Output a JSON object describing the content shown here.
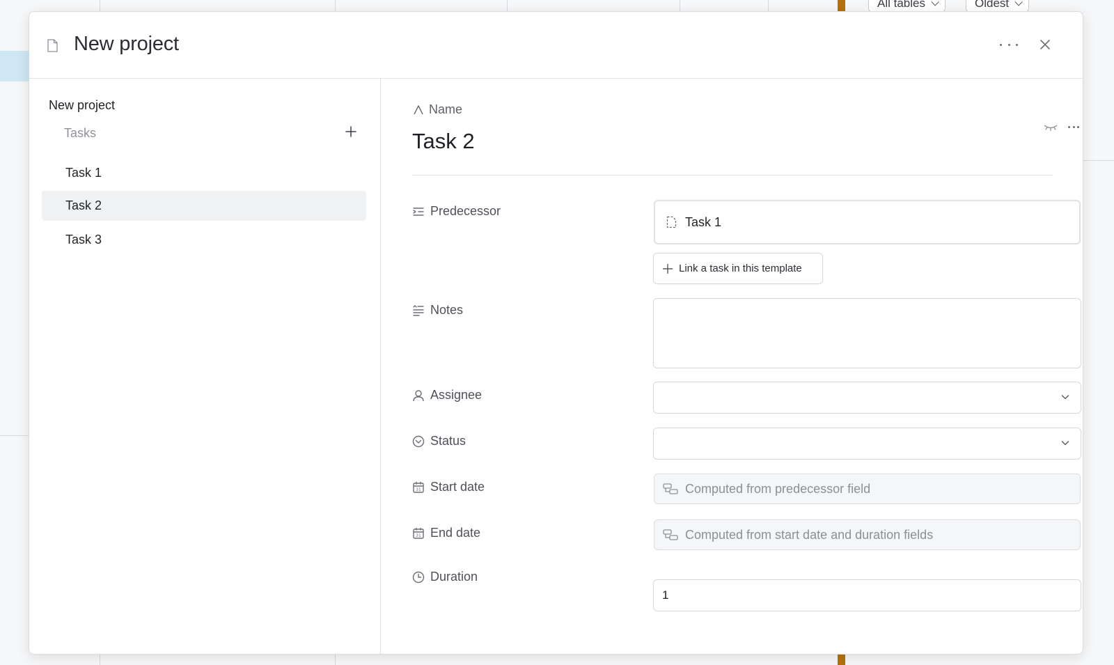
{
  "background": {
    "pill_all_tables": "All tables",
    "pill_oldest": "Oldest"
  },
  "modal": {
    "title": "New project",
    "more_icon": "ellipsis-icon",
    "close_icon": "close-icon"
  },
  "left": {
    "project_name": "New project",
    "tasks_heading": "Tasks",
    "tasks": [
      {
        "label": "Task 1"
      },
      {
        "label": "Task 2",
        "selected": true
      },
      {
        "label": "Task 3"
      }
    ]
  },
  "record": {
    "name_label": "Name",
    "title": "Task 2",
    "fields": {
      "predecessor": {
        "label": "Predecessor",
        "value": "Task 1",
        "link_button": "Link a task in this template"
      },
      "notes": {
        "label": "Notes",
        "value": ""
      },
      "assignee": {
        "label": "Assignee",
        "value": ""
      },
      "status": {
        "label": "Status",
        "value": ""
      },
      "start_date": {
        "label": "Start date",
        "placeholder": "Computed from predecessor field"
      },
      "end_date": {
        "label": "End date",
        "placeholder": "Computed from start date and duration fields"
      },
      "duration": {
        "label": "Duration",
        "value": "1"
      }
    }
  },
  "colors": {
    "selected_row": "#f0f1f2",
    "accent_bar": "#b5720c",
    "background_selection": "#cfe6f3"
  }
}
